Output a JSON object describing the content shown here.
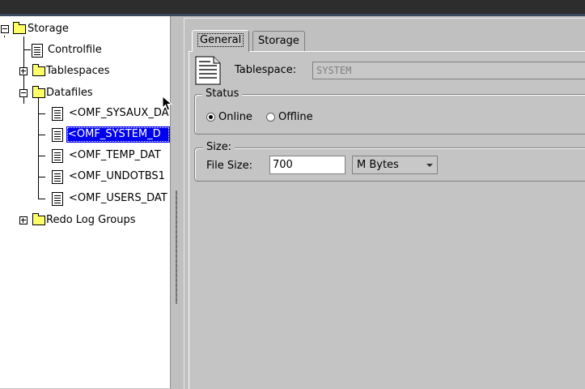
{
  "tree": {
    "root": "Storage",
    "controlfile": "Controlfile",
    "tablespaces": "Tablespaces",
    "datafiles": "Datafiles",
    "datafile_items": [
      "<OMF_SYSAUX_DA",
      "<OMF_SYSTEM_D",
      "<OMF_TEMP_DAT",
      "<OMF_UNDOTBS1",
      "<OMF_USERS_DAT"
    ],
    "redo": "Redo Log Groups"
  },
  "tabs": {
    "general": "General",
    "storage": "Storage"
  },
  "tablespace": {
    "label": "Tablespace:",
    "value": "SYSTEM"
  },
  "status": {
    "title": "Status",
    "online": "Online",
    "offline": "Offline",
    "selected": "Online"
  },
  "size": {
    "title": "Size:",
    "label": "File Size:",
    "value": "700",
    "unit": "M Bytes"
  },
  "colors": {
    "selection": "#0000ee",
    "folder": "#ffff66",
    "panel": "#c0c0c0"
  }
}
